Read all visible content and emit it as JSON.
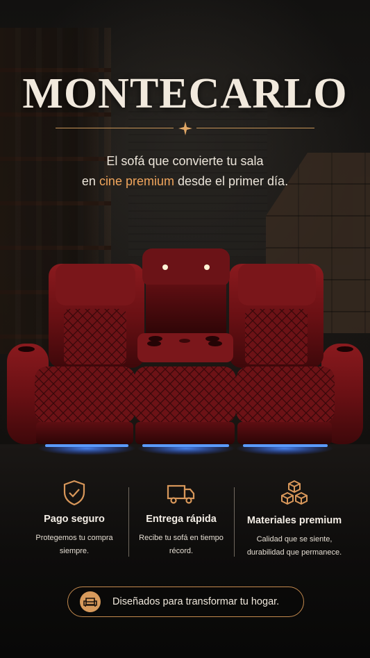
{
  "brand": {
    "title": "MONTECARLO"
  },
  "tagline": {
    "line1": "El sofá que convierte tu sala",
    "line2_before": "en ",
    "line2_accent": "cine premium",
    "line2_after": " desde el primer día."
  },
  "features": [
    {
      "icon": "shield-check-icon",
      "title": "Pago seguro",
      "desc_line1": "Protegemos tu compra",
      "desc_line2": "siempre."
    },
    {
      "icon": "delivery-truck-icon",
      "title": "Entrega rápida",
      "desc_line1": "Recibe tu sofá en tiempo",
      "desc_line2": "récord."
    },
    {
      "icon": "stacked-boxes-icon",
      "title": "Materiales premium",
      "desc_line1": "Calidad que se siente,",
      "desc_line2": "durabilidad que permanece."
    }
  ],
  "cta": {
    "icon": "sofa-icon",
    "label": "Diseñados para transformar tu hogar."
  },
  "colors": {
    "accent": "#f0a55c",
    "gold": "#c99658",
    "leather": "#6e1216",
    "led": "#3a7bff"
  }
}
